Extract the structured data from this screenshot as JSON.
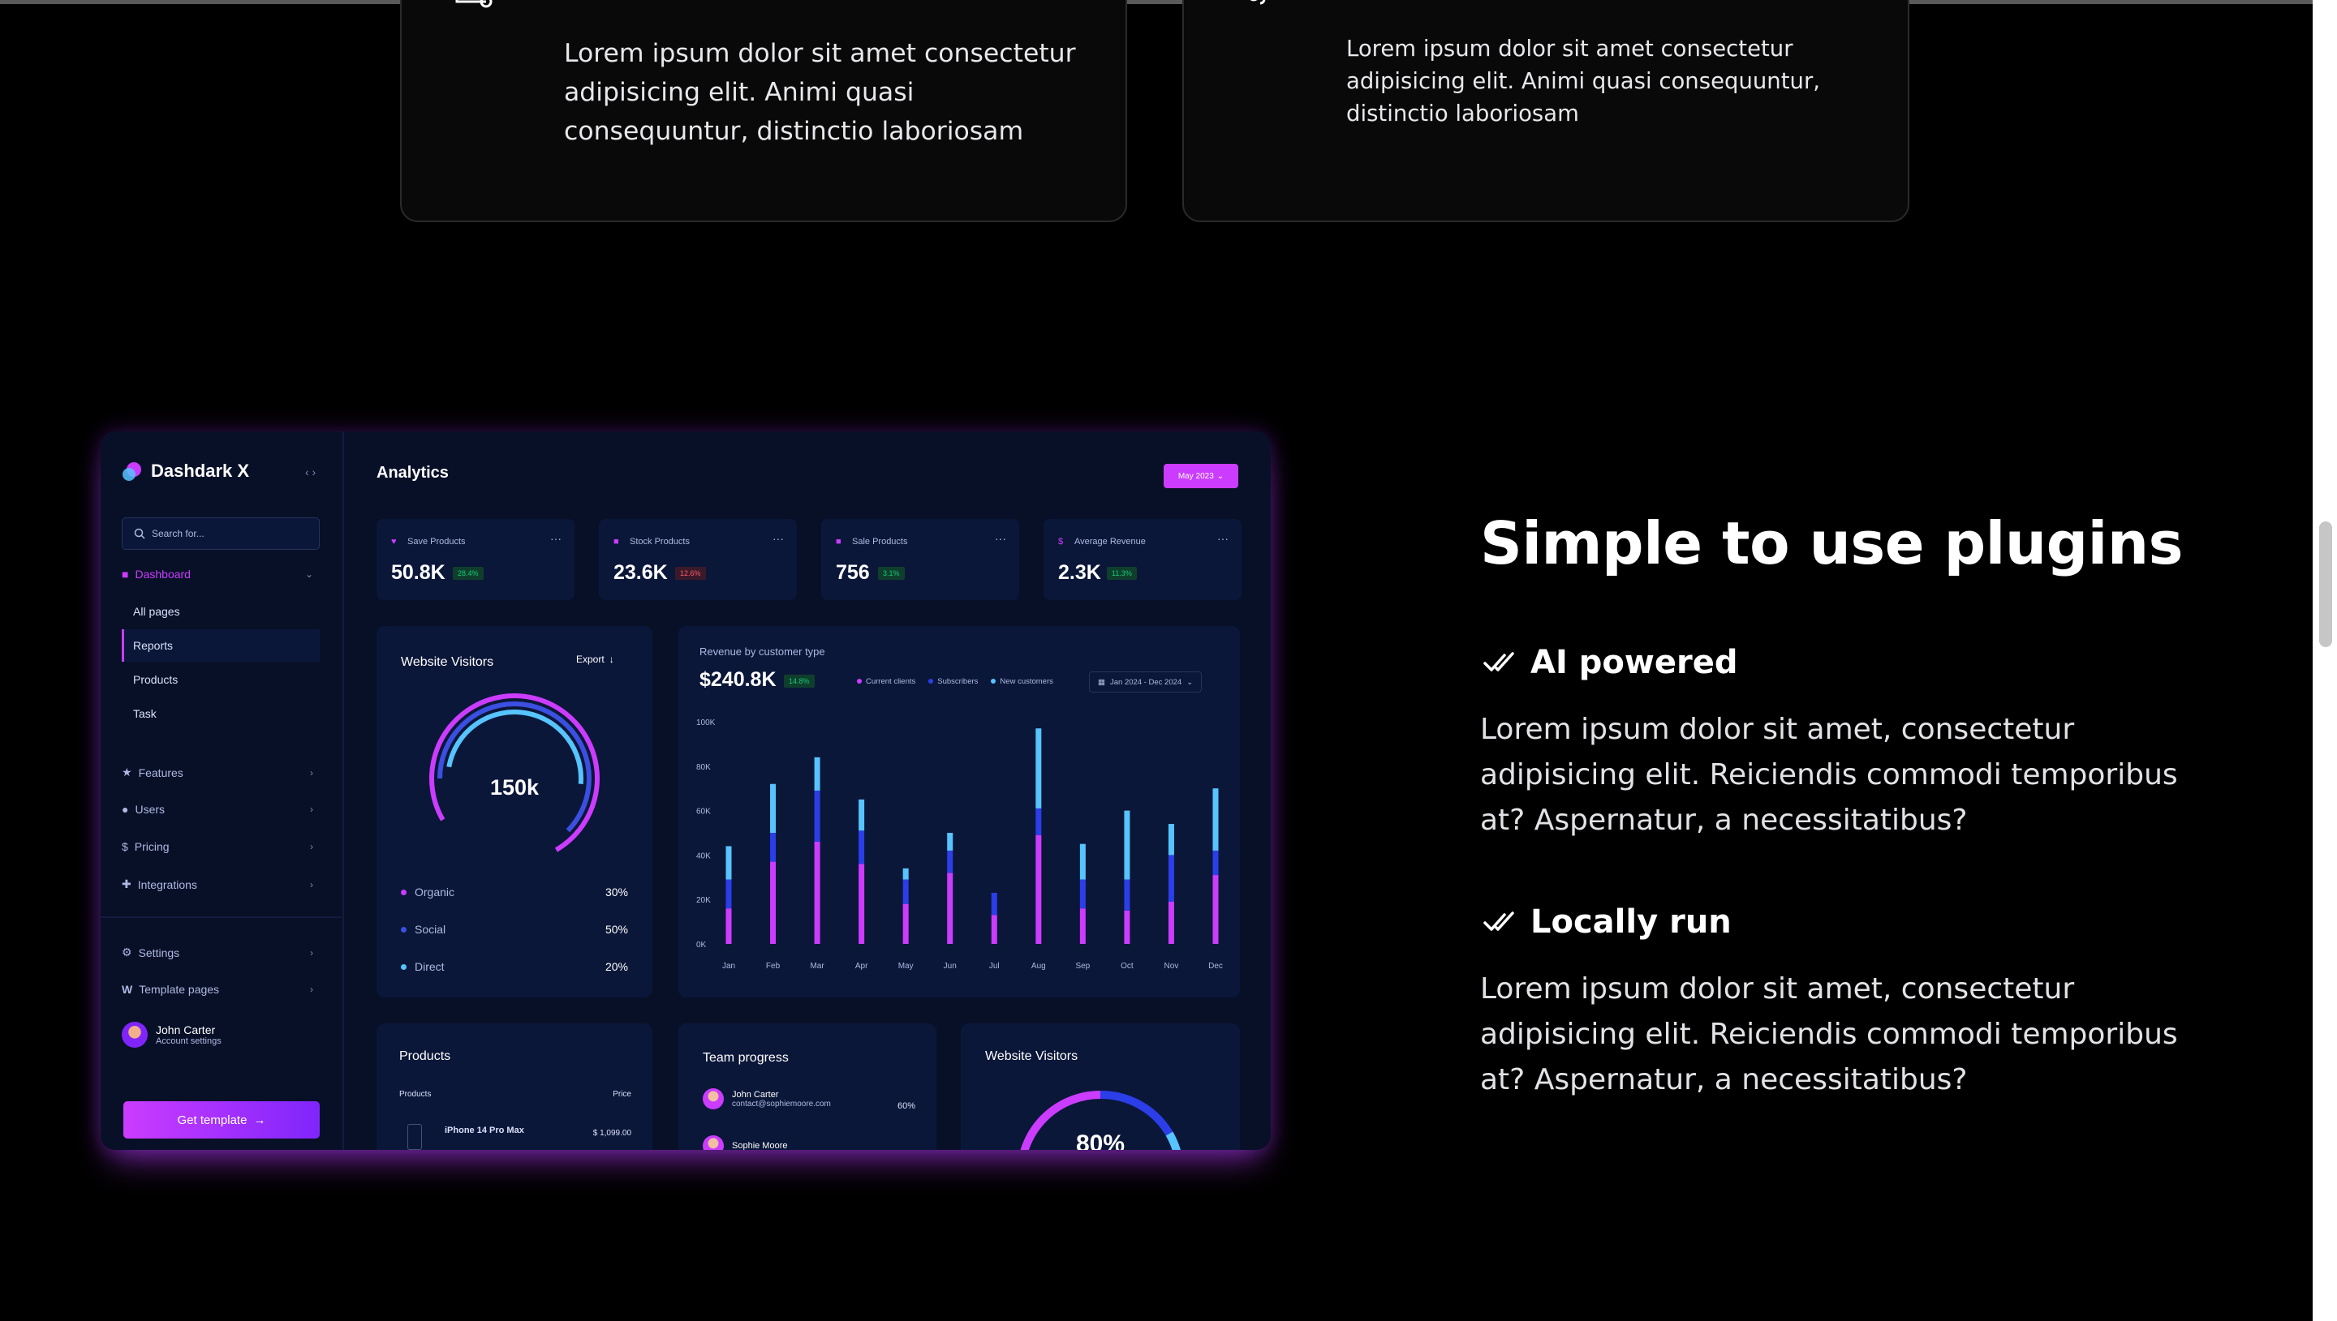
{
  "feature_cards": [
    {
      "text": "Lorem ipsum dolor sit amet consectetur adipisicing elit. Animi quasi consequuntur, distinctio laboriosam"
    },
    {
      "text": "Lorem ipsum dolor sit amet consectetur adipisicing elit. Animi quasi consequuntur, distinctio laboriosam"
    }
  ],
  "section": {
    "title": "Simple to use plugins",
    "features": [
      {
        "heading": "AI powered",
        "body": "Lorem ipsum dolor sit amet, consectetur adipisicing elit. Reiciendis commodi temporibus at? Aspernatur, a necessitatibus?"
      },
      {
        "heading": "Locally run",
        "body": "Lorem ipsum dolor sit amet, consectetur adipisicing elit. Reiciendis commodi temporibus at? Aspernatur, a necessitatibus?"
      }
    ]
  },
  "dashboard": {
    "brand": "Dashdark X",
    "search_placeholder": "Search for...",
    "nav": {
      "dashboard": "Dashboard",
      "sub": [
        "All pages",
        "Reports",
        "Products",
        "Task"
      ],
      "features": "Features",
      "users": "Users",
      "pricing": "Pricing",
      "integrations": "Integrations",
      "settings": "Settings",
      "template_pages": "Template pages"
    },
    "user": {
      "name": "John Carter",
      "sub": "Account settings"
    },
    "get_template": "Get template",
    "title": "Analytics",
    "date_button": "May 2023",
    "stats": [
      {
        "label": "Save Products",
        "value": "50.8K",
        "badge": "28.4%",
        "trend": "up"
      },
      {
        "label": "Stock Products",
        "value": "23.6K",
        "badge": "12.6%",
        "trend": "down"
      },
      {
        "label": "Sale Products",
        "value": "756",
        "badge": "3.1%",
        "trend": "up"
      },
      {
        "label": "Average Revenue",
        "value": "2.3K",
        "badge": "11.3%",
        "trend": "up"
      }
    ],
    "visitors": {
      "title": "Website Visitors",
      "export": "Export",
      "center": "150k",
      "legend": [
        {
          "label": "Organic",
          "pct": "30%",
          "color": "#cb3cff"
        },
        {
          "label": "Social",
          "pct": "50%",
          "color": "#3b4fe0"
        },
        {
          "label": "Direct",
          "pct": "20%",
          "color": "#57c3ff"
        }
      ]
    },
    "revenue": {
      "subtitle": "Revenue by customer type",
      "value": "$240.8K",
      "badge": "14.8%",
      "legend": [
        "Current clients",
        "Subscribers",
        "New customers"
      ],
      "range": "Jan 2024 - Dec 2024"
    },
    "products": {
      "title": "Products",
      "col_product": "Products",
      "col_price": "Price",
      "row_name": "iPhone 14 Pro Max",
      "row_price": "$ 1,099.00"
    },
    "team": {
      "title": "Team progress",
      "rows": [
        {
          "name": "John Carter",
          "email": "contact@sophiemoore.com",
          "pct": "60%"
        },
        {
          "name": "Sophie Moore",
          "email": "",
          "pct": ""
        }
      ]
    },
    "visitors2": {
      "title": "Website Visitors",
      "center": "80%"
    }
  },
  "chart_data": {
    "type": "bar",
    "stacked": true,
    "categories": [
      "Jan",
      "Feb",
      "Mar",
      "Apr",
      "May",
      "Jun",
      "Jul",
      "Aug",
      "Sep",
      "Oct",
      "Nov",
      "Dec"
    ],
    "y_ticks": [
      "0K",
      "20K",
      "40K",
      "60K",
      "80K",
      "100K"
    ],
    "ylim": [
      0,
      100
    ],
    "series": [
      {
        "name": "Current clients",
        "color": "#cb3cff",
        "values": [
          16,
          37,
          46,
          36,
          18,
          32,
          13,
          49,
          16,
          15,
          19,
          31
        ]
      },
      {
        "name": "Subscribers",
        "color": "#2b3ee8",
        "values": [
          13,
          13,
          23,
          15,
          11,
          10,
          10,
          12,
          13,
          14,
          21,
          11
        ]
      },
      {
        "name": "New customers",
        "color": "#57c3ff",
        "values": [
          15,
          22,
          15,
          14,
          5,
          8,
          0,
          36,
          16,
          31,
          14,
          28
        ]
      }
    ],
    "colors": {
      "accent": "#cb3cff",
      "panel": "#0b1739",
      "bg": "#081028"
    }
  }
}
